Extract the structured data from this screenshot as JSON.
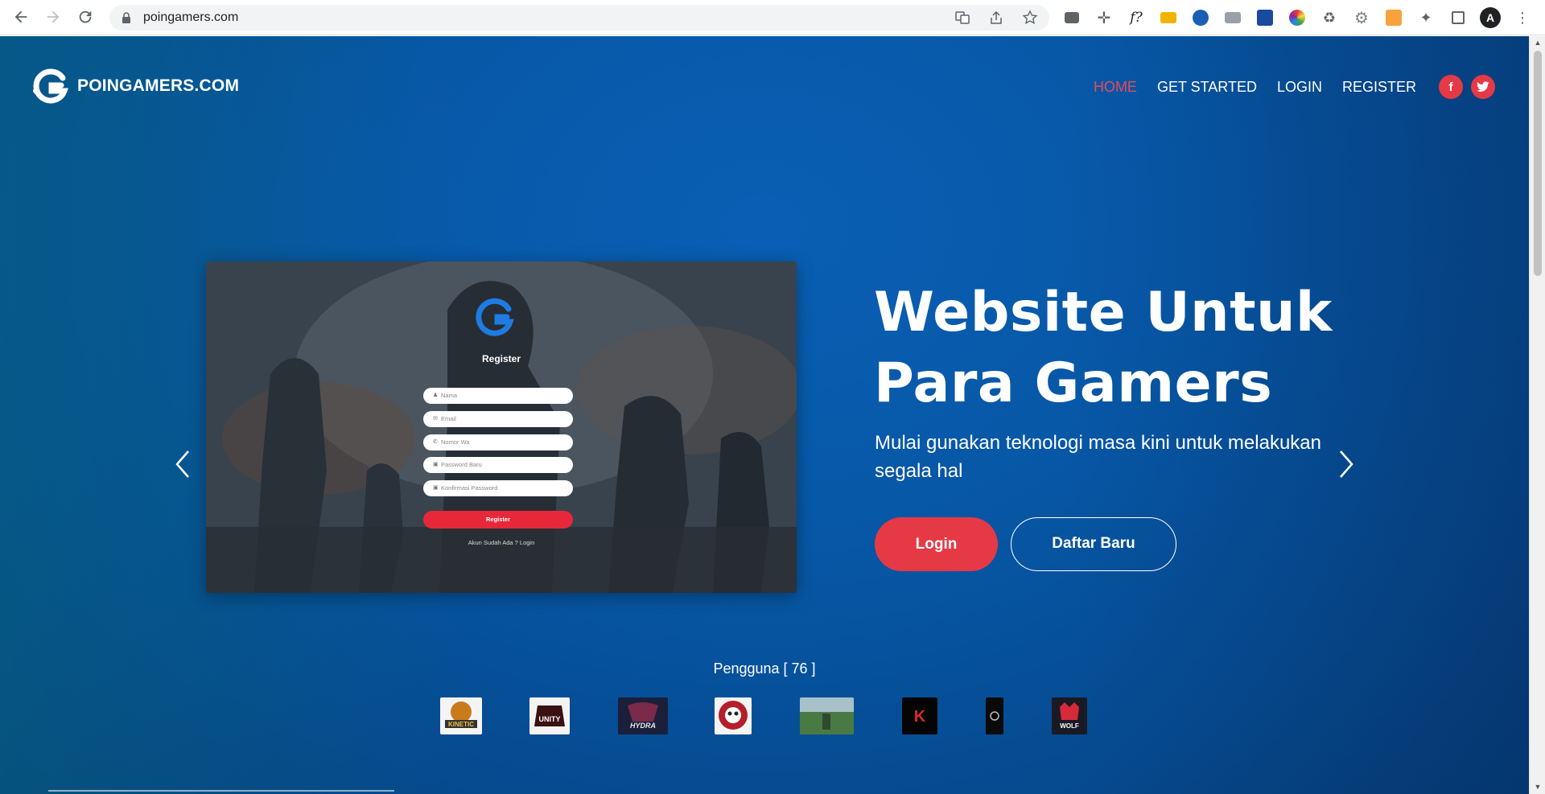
{
  "browser": {
    "url": "poingamers.com",
    "profile_initial": "A",
    "extensions": [
      "tab-search-icon",
      "move-icon",
      "font-icon",
      "folder-icon",
      "circle-icon",
      "camera-icon",
      "book-icon",
      "color-wheel-icon",
      "recycle-icon",
      "gear-icon",
      "orange-box-icon",
      "puzzle-icon",
      "sidebar-icon"
    ]
  },
  "header": {
    "logo_text": "POINGAMERS.COM",
    "menu": [
      {
        "label": "HOME",
        "active": true
      },
      {
        "label": "GET STARTED",
        "active": false
      },
      {
        "label": "LOGIN",
        "active": false
      },
      {
        "label": "REGISTER",
        "active": false
      }
    ],
    "social": [
      {
        "name": "facebook-icon",
        "glyph": "f"
      },
      {
        "name": "twitter-icon",
        "glyph": "t"
      }
    ]
  },
  "slide": {
    "form_title": "Register",
    "fields": [
      {
        "icon": "user-icon",
        "glyph": "♟",
        "placeholder": "Nama"
      },
      {
        "icon": "mail-icon",
        "glyph": "✉",
        "placeholder": "Email"
      },
      {
        "icon": "phone-icon",
        "glyph": "✆",
        "placeholder": "Nomor Wa"
      },
      {
        "icon": "lock-icon",
        "glyph": "🔒︎",
        "placeholder": "Password Baru"
      },
      {
        "icon": "lock-icon",
        "glyph": "🔒︎",
        "placeholder": "Konfirmasi Password"
      }
    ],
    "submit_label": "Register",
    "footer_text": "Akun Sudah Ada ? Login"
  },
  "hero": {
    "title_line1": "Website Untuk",
    "title_line2": "Para Gamers",
    "subtitle": "Mulai gunakan teknologi masa kini untuk melakukan segala hal",
    "login_label": "Login",
    "register_label": "Daftar Baru"
  },
  "users": {
    "title": "Pengguna [ 76 ]",
    "logos": [
      {
        "name": "kinetic-logo",
        "label": "KINETIC",
        "bg": "#f4f4f4",
        "fg": "#c97a1a"
      },
      {
        "name": "unity-logo",
        "label": "UNITY",
        "bg": "#f4f4f4",
        "fg": "#6a1a1a"
      },
      {
        "name": "hydra-logo",
        "label": "HYDRA",
        "bg": "#1a1f3a",
        "fg": "#c8324a"
      },
      {
        "name": "skull-logo",
        "label": "",
        "bg": "#f4f4f4",
        "fg": "#b51e2a"
      },
      {
        "name": "photo-logo",
        "label": "",
        "bg": "#5e8a5a",
        "fg": "#2e4a30"
      },
      {
        "name": "k-logo",
        "label": "K",
        "bg": "#050505",
        "fg": "#d62a2a"
      },
      {
        "name": "dark-logo",
        "label": "",
        "bg": "#0a0a0a",
        "fg": "#bbbbbb"
      },
      {
        "name": "wolf-logo",
        "label": "WOLF",
        "bg": "#1a1a24",
        "fg": "#d62a3a"
      }
    ]
  },
  "colors": {
    "accent": "#e63946",
    "page_bg": "#0757a6"
  }
}
